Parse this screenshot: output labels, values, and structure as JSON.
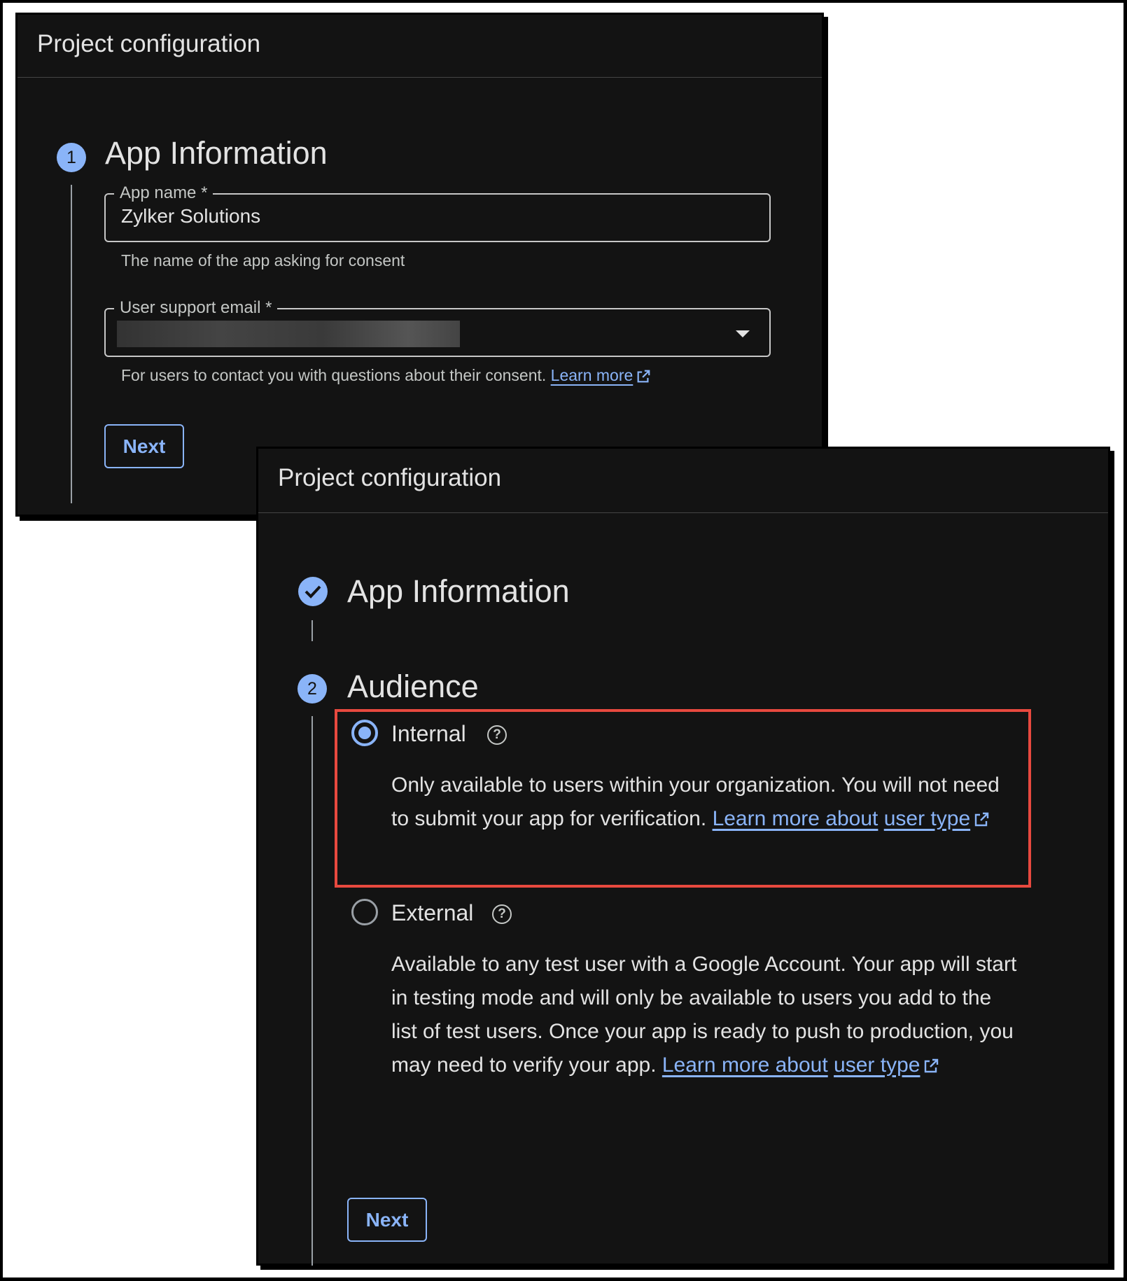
{
  "panel1": {
    "title": "Project configuration",
    "step_number": "1",
    "step_title": "App Information",
    "app_name_label": "App name *",
    "app_name_value": "Zylker Solutions",
    "app_name_helper": "The name of the app asking for consent",
    "support_email_label": "User support email *",
    "support_email_helper": "For users to contact you with questions about their consent.",
    "support_email_link": "Learn more",
    "next_label": "Next"
  },
  "panel2": {
    "title": "Project configuration",
    "step1_title": "App Information",
    "step2_number": "2",
    "step2_title": "Audience",
    "internal": {
      "label": "Internal",
      "selected": true,
      "description": "Only available to users within your organization. You will not need to submit your app for verification.",
      "link_part1": "Learn more about",
      "link_part2": "user type"
    },
    "external": {
      "label": "External",
      "selected": false,
      "description": "Available to any test user with a Google Account. Your app will start in testing mode and will only be available to users you add to the list of test users. Once your app is ready to push to production, you may need to verify your app.",
      "link_part1": "Learn more about",
      "link_part2": "user type"
    },
    "next_label": "Next"
  },
  "icons": {
    "help": "?",
    "external_link": "external-link-icon",
    "check": "check-circle-icon",
    "dropdown": "caret-down-icon"
  },
  "colors": {
    "panel_bg": "#131313",
    "accent": "#8ab4f8",
    "highlight": "#e8493f",
    "text": "#e3e3e3"
  }
}
